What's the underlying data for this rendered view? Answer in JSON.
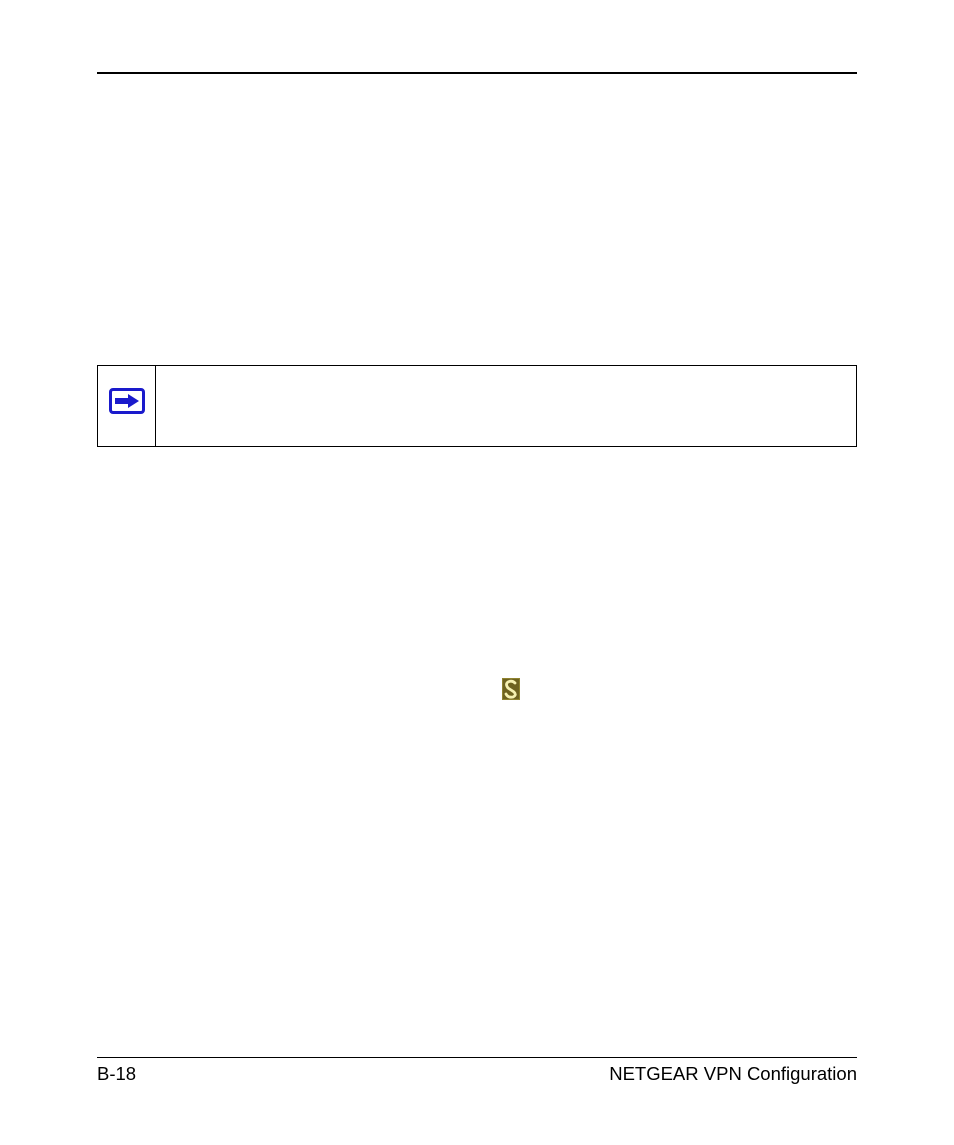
{
  "footer": {
    "page_number": "B-18",
    "title": "NETGEAR VPN Configuration"
  },
  "icons": {
    "note": "arrow-right-icon",
    "inline": "s-logo-icon"
  }
}
